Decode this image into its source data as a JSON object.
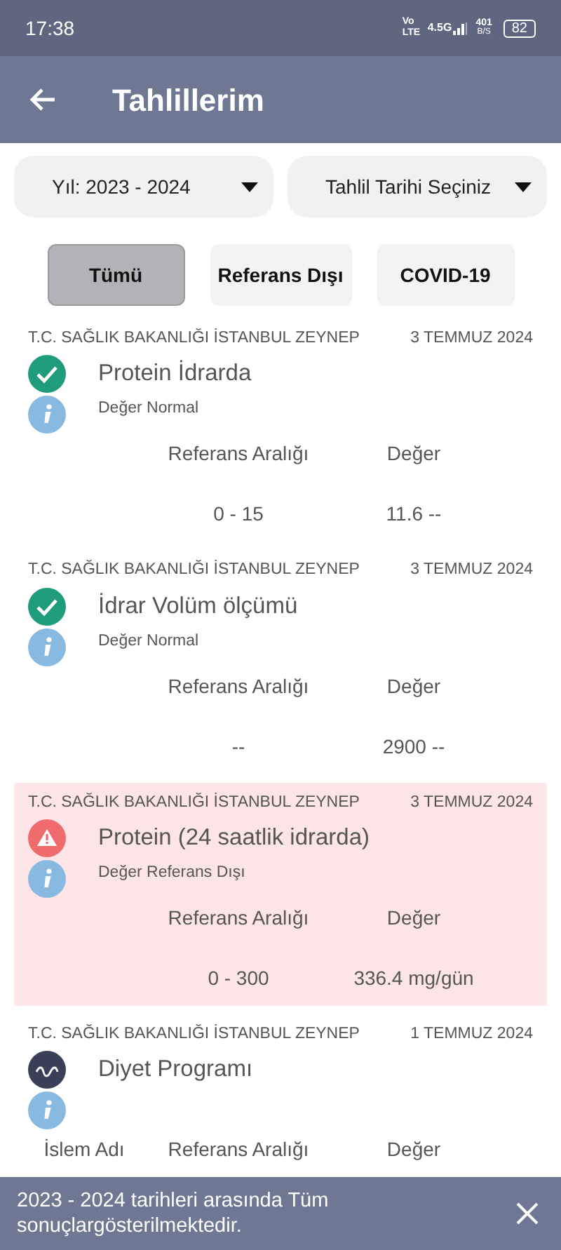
{
  "status_bar": {
    "time": "17:38",
    "network": "Vo LTE",
    "generation": "4.5G",
    "speed": "401",
    "speed_unit": "B/S",
    "battery": "82"
  },
  "app_bar": {
    "title": "Tahlillerim"
  },
  "filters": [
    {
      "label": "Yıl: 2023 - 2024"
    },
    {
      "label": "Tahlil Tarihi Seçiniz"
    }
  ],
  "chips": [
    {
      "label": "Tümü",
      "selected": true
    },
    {
      "label": "Referans Dışı",
      "selected": false
    },
    {
      "label": "COVID-19",
      "selected": false
    }
  ],
  "results": [
    {
      "institution": "T.C. SAĞLIK BAKANLIĞI İSTANBUL ZEYNEP",
      "date": "3 TEMMUZ 2024",
      "title": "Protein İdrarda",
      "kind": "normal",
      "note": "Değer Normal",
      "flagged": false,
      "columns": [
        "Referans Aralığı",
        "Değer"
      ],
      "values": [
        "0 - 15",
        "11.6 --"
      ]
    },
    {
      "institution": "T.C. SAĞLIK BAKANLIĞI İSTANBUL ZEYNEP",
      "date": "3 TEMMUZ 2024",
      "title": "İdrar Volüm ölçümü",
      "kind": "normal",
      "note": "Değer Normal",
      "flagged": false,
      "columns": [
        "Referans Aralığı",
        "Değer"
      ],
      "values": [
        "--",
        "2900 --"
      ]
    },
    {
      "institution": "T.C. SAĞLIK BAKANLIĞI İSTANBUL ZEYNEP",
      "date": "3 TEMMUZ 2024",
      "title": "Protein (24 saatlik idrarda)",
      "kind": "abnormal",
      "note": "Değer Referans Dışı",
      "flagged": true,
      "columns": [
        "Referans Aralığı",
        "Değer"
      ],
      "values": [
        "0 - 300",
        "336.4 mg/gün"
      ]
    },
    {
      "institution": "T.C. SAĞLIK BAKANLIĞI İSTANBUL ZEYNEP",
      "date": "1 TEMMUZ 2024",
      "title": "Diyet Programı",
      "kind": "program",
      "flagged": false,
      "columns": [
        "İslem Adı",
        "Referans Aralığı",
        "Değer"
      ]
    }
  ],
  "snackbar": {
    "message": "2023 - 2024 tarihleri arasında Tüm sonuçlargösterilmektedir."
  }
}
